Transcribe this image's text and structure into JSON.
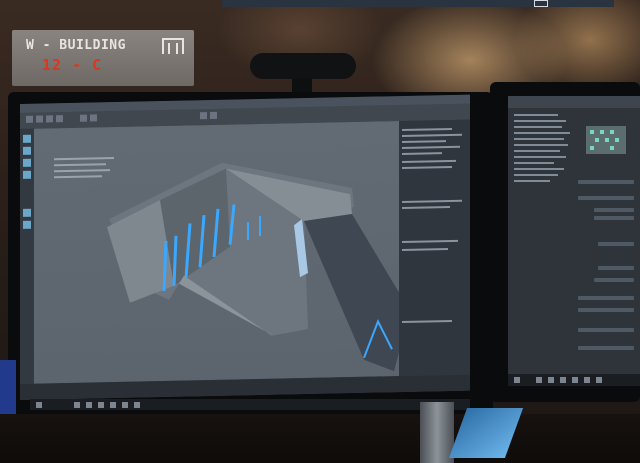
{
  "sign": {
    "line1": "W - BUILDING",
    "line2": "12 - C"
  },
  "colors": {
    "sign_red": "#d9381f",
    "model_blue": "#3aa8ff",
    "viewport_gray": "#5e666f"
  },
  "icons": {
    "webcam": "webcam-icon",
    "logo": "building-logo-icon"
  }
}
